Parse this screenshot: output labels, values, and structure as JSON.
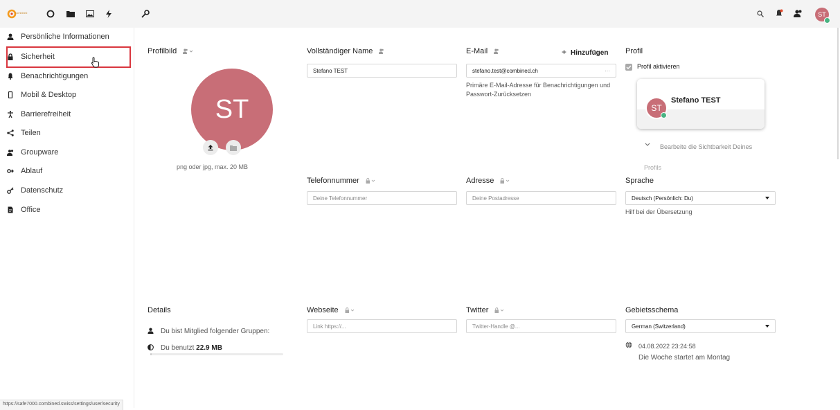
{
  "app": {
    "logo_text": "combined",
    "status_url": "https://safe7000.combined.swiss/settings/user/security",
    "user_avatar": "ST"
  },
  "sidebar": {
    "items": [
      {
        "label": "Persönliche Informationen",
        "icon": "user-icon"
      },
      {
        "label": "Sicherheit",
        "icon": "lock-icon"
      },
      {
        "label": "Benachrichtigungen",
        "icon": "bell-icon"
      },
      {
        "label": "Mobil & Desktop",
        "icon": "mobile-icon"
      },
      {
        "label": "Barrierefreiheit",
        "icon": "accessibility-icon"
      },
      {
        "label": "Teilen",
        "icon": "share-icon"
      },
      {
        "label": "Groupware",
        "icon": "group-icon"
      },
      {
        "label": "Ablauf",
        "icon": "flow-icon"
      },
      {
        "label": "Datenschutz",
        "icon": "key-icon"
      },
      {
        "label": "Office",
        "icon": "document-icon"
      }
    ]
  },
  "profile_picture": {
    "title": "Profilbild",
    "avatar": "ST",
    "hint": "png oder jpg, max. 20 MB"
  },
  "full_name": {
    "title": "Vollständiger Name",
    "value": "Stefano TEST"
  },
  "email": {
    "title": "E-Mail",
    "add_label": "Hinzufügen",
    "value": "stefano.test@combined.ch",
    "more": "···",
    "description": "Primäre E-Mail-Adresse für Benachrichtigungen und Passwort-Zurücksetzen"
  },
  "profile": {
    "title": "Profil",
    "enable_label": "Profil aktivieren",
    "card_name": "Stefano TEST",
    "card_avatar": "ST",
    "visibility_text": "Bearbeite die Sichtbarkeit Deines",
    "visibility_text2": "Profils"
  },
  "phone": {
    "title": "Telefonnummer",
    "placeholder": "Deine Telefonnummer"
  },
  "address": {
    "title": "Adresse",
    "placeholder": "Deine Postadresse"
  },
  "language": {
    "title": "Sprache",
    "value": "Deutsch (Persönlich: Du)",
    "help": "Hilf bei der Übersetzung"
  },
  "details": {
    "title": "Details",
    "groups": "Du bist Mitglied folgender Gruppen:",
    "usage_prefix": "Du benutzt",
    "usage_value": "22.9 MB",
    "usage_fraction": 0.01
  },
  "website": {
    "title": "Webseite",
    "placeholder": "Link https://..."
  },
  "twitter": {
    "title": "Twitter",
    "placeholder": "Twitter-Handle @..."
  },
  "locale": {
    "title": "Gebietsschema",
    "value": "German (Switzerland)",
    "datetime": "04.08.2022 23:24:58",
    "week_start": "Die Woche startet am Montag"
  },
  "colors": {
    "avatar": "#c86e77",
    "highlight": "#d9363e",
    "status_online": "#49b382",
    "logo_orange": "#f49a1c"
  }
}
